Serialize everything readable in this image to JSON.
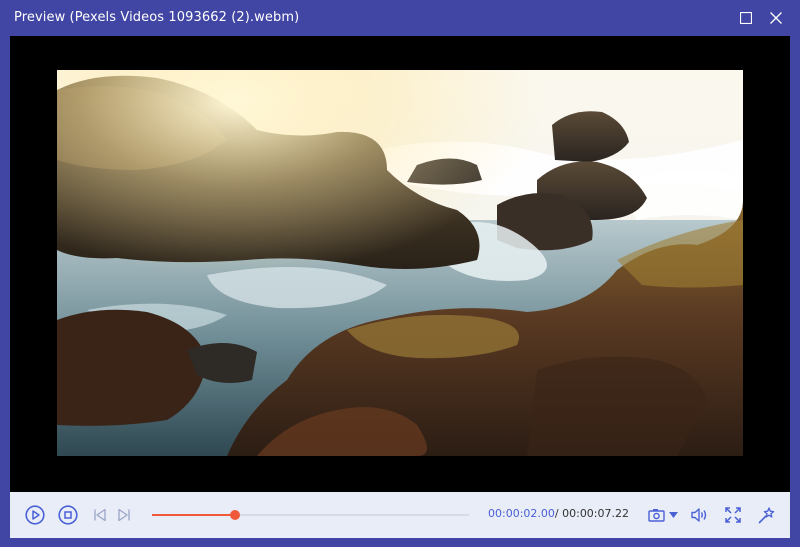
{
  "window": {
    "title": "Preview (Pexels Videos 1093662 (2).webm)"
  },
  "player": {
    "current_time": "00:00:02.00",
    "separator": "/ ",
    "total_time": "00:00:07.22",
    "progress": 0.262
  },
  "icons": {
    "play": "play-circle-icon",
    "stop": "stop-circle-icon",
    "prev": "skip-previous-icon",
    "next": "skip-next-icon",
    "snapshot": "camera-icon",
    "volume": "volume-icon",
    "fullscreen": "fullscreen-icon",
    "effects": "magic-wand-icon"
  },
  "colors": {
    "titlebar": "#4145a3",
    "accent": "#4a61d6",
    "progress": "#f05a3a",
    "control_bg": "#e9edf7"
  }
}
